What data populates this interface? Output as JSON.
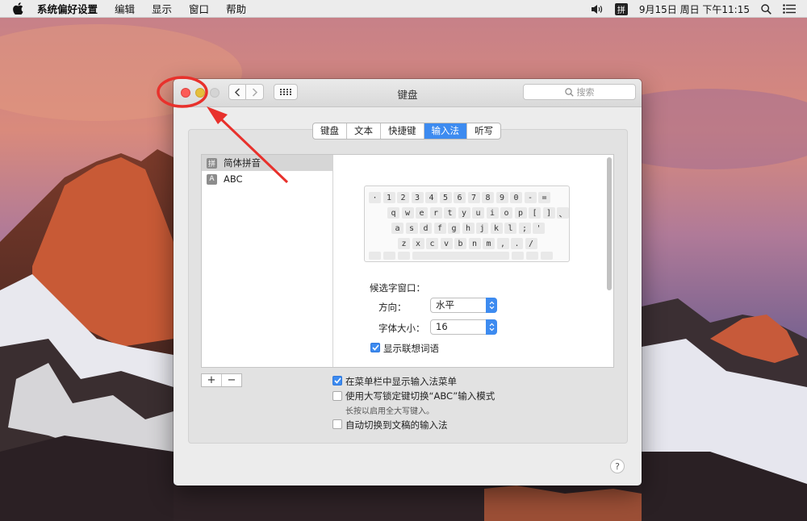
{
  "menubar": {
    "items": [
      "系统偏好设置",
      "编辑",
      "显示",
      "窗口",
      "帮助"
    ],
    "input_indicator": "拼",
    "clock": "9月15日 周日 下午11:15"
  },
  "window": {
    "title": "键盘",
    "search_placeholder": "搜索",
    "tabs": [
      {
        "label": "键盘",
        "active": false
      },
      {
        "label": "文本",
        "active": false
      },
      {
        "label": "快捷键",
        "active": false
      },
      {
        "label": "输入法",
        "active": true
      },
      {
        "label": "听写",
        "active": false
      }
    ]
  },
  "input_sources": [
    {
      "icon": "拼",
      "label": "简体拼音",
      "selected": true
    },
    {
      "icon": "A",
      "label": "ABC",
      "selected": false
    }
  ],
  "keyboard": {
    "rows": [
      [
        "·",
        "1",
        "2",
        "3",
        "4",
        "5",
        "6",
        "7",
        "8",
        "9",
        "0",
        "-",
        "="
      ],
      [
        "q",
        "w",
        "e",
        "r",
        "t",
        "y",
        "u",
        "i",
        "o",
        "p",
        "[",
        "]",
        "、"
      ],
      [
        "a",
        "s",
        "d",
        "f",
        "g",
        "h",
        "j",
        "k",
        "l",
        ";",
        "'"
      ],
      [
        "z",
        "x",
        "c",
        "v",
        "b",
        "n",
        "m",
        ",",
        ".",
        "/"
      ]
    ]
  },
  "candidate": {
    "header": "候选字窗口：",
    "orientation_label": "方向：",
    "orientation_value": "水平",
    "font_size_label": "字体大小：",
    "font_size_value": "16",
    "show_predictive_label": "显示联想词语",
    "show_predictive_checked": true
  },
  "options": {
    "show_menu_label": "在菜单栏中显示输入法菜单",
    "show_menu_checked": true,
    "capslock_label": "使用大写锁定键切换“ABC”输入模式",
    "capslock_checked": false,
    "capslock_hint": "长按以启用全大写键入。",
    "auto_switch_label": "自动切换到文稿的输入法",
    "auto_switch_checked": false
  },
  "buttons": {
    "add": "+",
    "remove": "−",
    "help": "?"
  },
  "colors": {
    "accent": "#3d8bf0",
    "annotation": "#e8312c",
    "close": "#fc5b57"
  }
}
